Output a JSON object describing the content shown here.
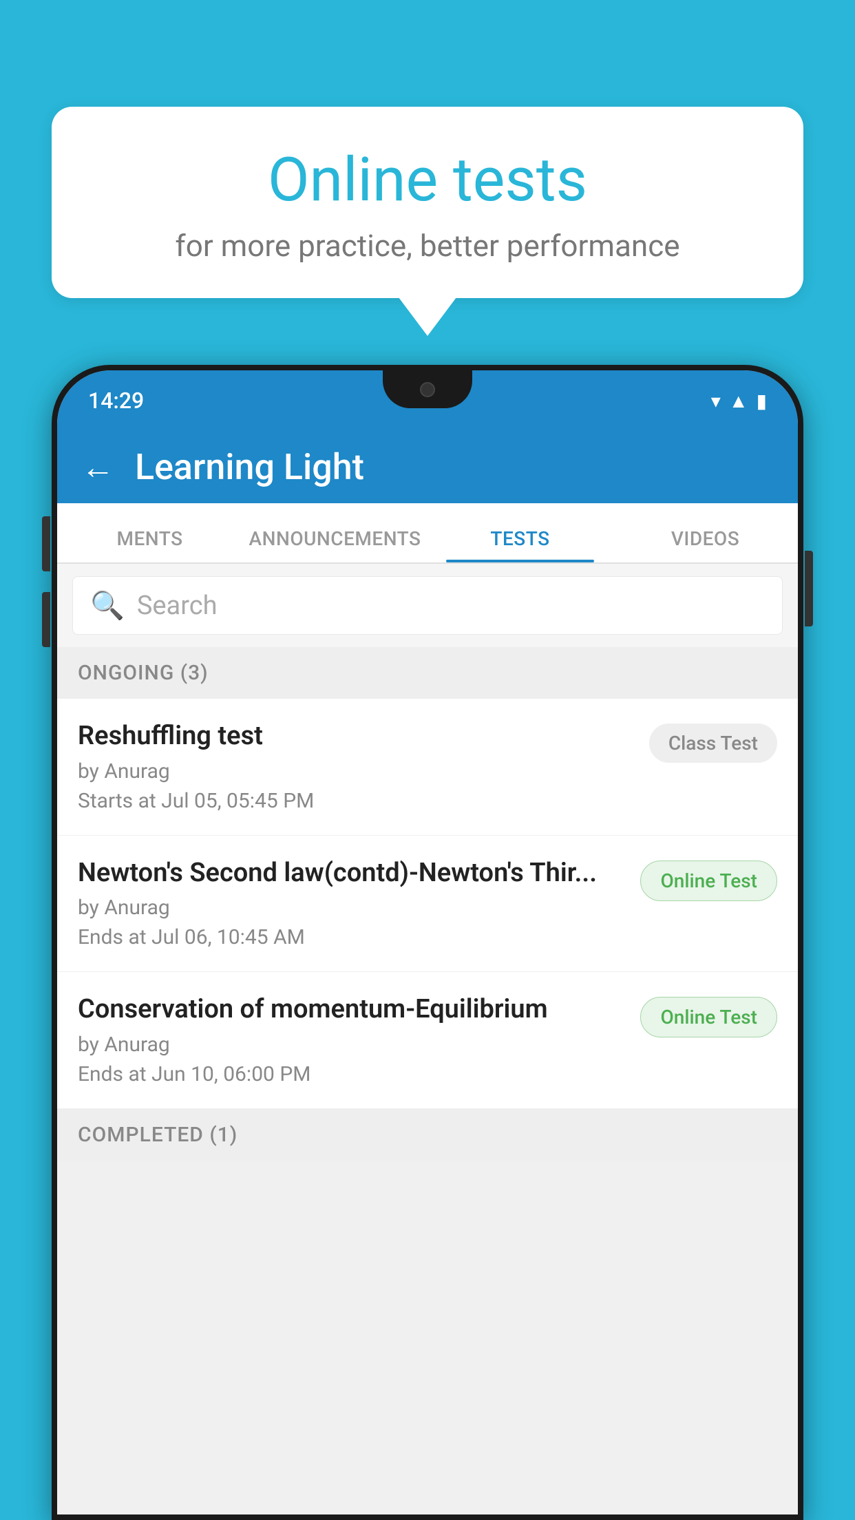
{
  "background_color": "#29b6d8",
  "bubble": {
    "title": "Online tests",
    "subtitle": "for more practice, better performance"
  },
  "phone": {
    "status_time": "14:29",
    "app_title": "Learning Light",
    "tabs": [
      {
        "id": "ments",
        "label": "MENTS",
        "active": false
      },
      {
        "id": "announcements",
        "label": "ANNOUNCEMENTS",
        "active": false
      },
      {
        "id": "tests",
        "label": "TESTS",
        "active": true
      },
      {
        "id": "videos",
        "label": "VIDEOS",
        "active": false
      }
    ],
    "search_placeholder": "Search",
    "ongoing_section": "ONGOING (3)",
    "tests": [
      {
        "id": "reshuffling",
        "name": "Reshuffling test",
        "author": "by Anurag",
        "time": "Starts at  Jul 05, 05:45 PM",
        "badge": "Class Test",
        "badge_type": "class"
      },
      {
        "id": "newtons",
        "name": "Newton's Second law(contd)-Newton's Thir...",
        "author": "by Anurag",
        "time": "Ends at  Jul 06, 10:45 AM",
        "badge": "Online Test",
        "badge_type": "online"
      },
      {
        "id": "conservation",
        "name": "Conservation of momentum-Equilibrium",
        "author": "by Anurag",
        "time": "Ends at  Jun 10, 06:00 PM",
        "badge": "Online Test",
        "badge_type": "online"
      }
    ],
    "completed_section": "COMPLETED (1)"
  }
}
